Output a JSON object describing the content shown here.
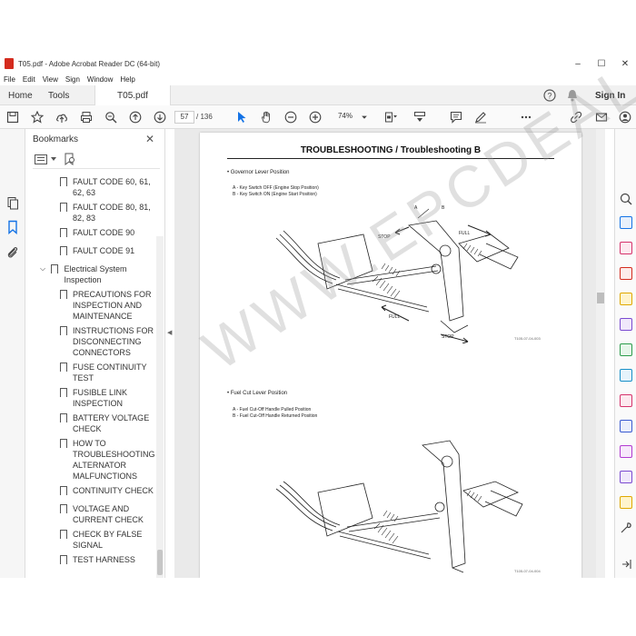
{
  "window": {
    "title": "T05.pdf - Adobe Acrobat Reader DC (64-bit)",
    "minimize": "–",
    "maximize": "☐",
    "close": "✕"
  },
  "menu": [
    "File",
    "Edit",
    "View",
    "Sign",
    "Window",
    "Help"
  ],
  "tabs": {
    "home": "Home",
    "tools": "Tools",
    "doc": "T05.pdf",
    "sign_in": "Sign In"
  },
  "toolbar": {
    "page_current": "57",
    "page_total": "/ 136",
    "zoom": "74%"
  },
  "bookmarks": {
    "header": "Bookmarks",
    "close": "✕",
    "items": [
      "FAULT CODE 60, 61, 62, 63",
      "FAULT CODE 80, 81, 82, 83",
      "FAULT CODE 90",
      "FAULT CODE 91",
      "Electrical System Inspection",
      "PRECAUTIONS FOR INSPECTION AND MAINTENANCE",
      "INSTRUCTIONS FOR DISCONNECTING CONNECTORS",
      "FUSE CONTINUITY TEST",
      "FUSIBLE LINK INSPECTION",
      "BATTERY VOLTAGE CHECK",
      "HOW TO TROUBLESHOOTING ALTERNATOR MALFUNCTIONS",
      "CONTINUITY CHECK",
      "VOLTAGE AND CURRENT CHECK",
      "CHECK BY FALSE SIGNAL",
      "TEST HARNESS"
    ]
  },
  "document": {
    "title": "TROUBLESHOOTING / Troubleshooting B",
    "section1": {
      "heading": "•  Governor Lever Position",
      "a": "A -   Key Switch OFF (Engine Stop Position)",
      "b": "B -   Key Switch ON (Engine Start Position)",
      "labels": {
        "a": "A",
        "b": "B",
        "stop_top": "STOP",
        "full_top": "FULL",
        "full_bottom": "FULL",
        "stop_bottom": "STOP"
      },
      "figcode": "T105-07-04-003"
    },
    "section2": {
      "heading": "•  Fuel Cut Lever Position",
      "a": "A -   Fuel Cut-Off Handle Pulled Position",
      "b": "B -   Fuel Cut-Off Handle Returned Position",
      "figcode": "T105-07-04-004"
    }
  },
  "watermark": "WWW.EPCDEAL.COM",
  "colors": {
    "accent": "#1473e6",
    "acrobat_red": "#d42b1e"
  }
}
